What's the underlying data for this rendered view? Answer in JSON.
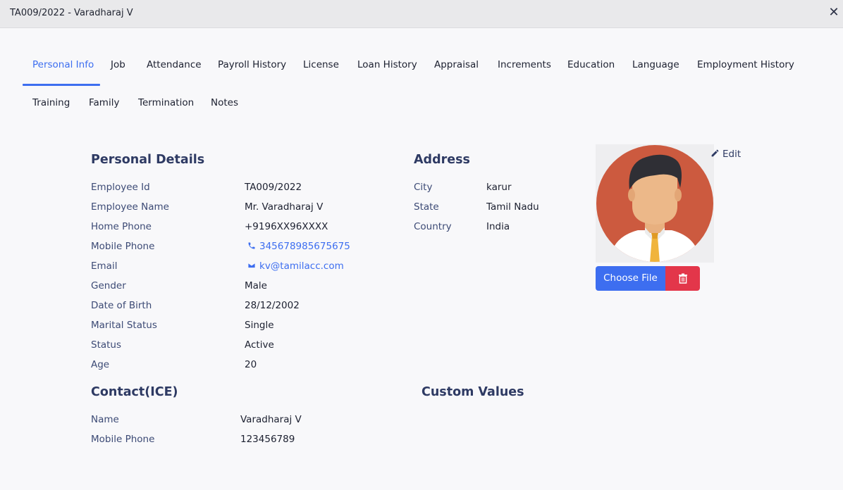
{
  "window": {
    "title": "TA009/2022 - Varadharaj V",
    "close_icon": "close-icon"
  },
  "tabs": [
    {
      "label": "Personal Info",
      "active": true
    },
    {
      "label": "Job"
    },
    {
      "label": "Attendance"
    },
    {
      "label": "Payroll History"
    },
    {
      "label": "License"
    },
    {
      "label": "Loan History"
    },
    {
      "label": "Appraisal"
    },
    {
      "label": "Increments"
    },
    {
      "label": "Education"
    },
    {
      "label": "Language"
    },
    {
      "label": "Employment History"
    },
    {
      "label": "Training"
    },
    {
      "label": "Family"
    },
    {
      "label": "Termination"
    },
    {
      "label": "Notes"
    }
  ],
  "personal": {
    "heading": "Personal Details",
    "rows": [
      {
        "label": "Employee Id",
        "value": "TA009/2022"
      },
      {
        "label": "Employee Name",
        "value": "Mr. Varadharaj V"
      },
      {
        "label": "Home Phone",
        "value": "+9196XX96XXXX"
      },
      {
        "label": "Mobile Phone",
        "value": "345678985675675",
        "icon": "phone-icon"
      },
      {
        "label": "Email",
        "value": "kv@tamilacc.com",
        "icon": "envelope-icon"
      },
      {
        "label": "Gender",
        "value": "Male"
      },
      {
        "label": "Date of Birth",
        "value": "28/12/2002"
      },
      {
        "label": "Marital Status",
        "value": "Single"
      },
      {
        "label": "Status",
        "value": "Active"
      },
      {
        "label": "Age",
        "value": "20"
      }
    ]
  },
  "address": {
    "heading": "Address",
    "rows": [
      {
        "label": "City",
        "value": "karur"
      },
      {
        "label": "State",
        "value": "Tamil Nadu"
      },
      {
        "label": "Country",
        "value": "India"
      }
    ]
  },
  "contact": {
    "heading": "Contact(ICE)",
    "rows": [
      {
        "label": "Name",
        "value": "Varadharaj V"
      },
      {
        "label": "Mobile Phone",
        "value": "123456789"
      }
    ]
  },
  "custom": {
    "heading": "Custom Values"
  },
  "photo": {
    "edit_label": "Edit",
    "edit_icon": "pencil-icon",
    "choose_label": "Choose File",
    "delete_icon": "trash-icon"
  },
  "colors": {
    "accent": "#3d6ef0",
    "danger": "#e3364a",
    "heading": "#2e3a63",
    "avatar_bg": "#cc5a3f"
  }
}
